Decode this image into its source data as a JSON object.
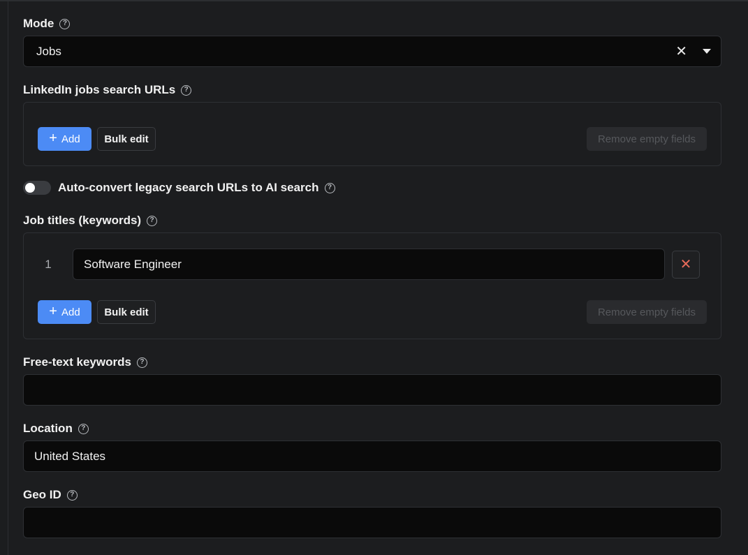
{
  "mode": {
    "label": "Mode",
    "value": "Jobs"
  },
  "linkedin_urls": {
    "label": "LinkedIn jobs search URLs",
    "add_label": "Add",
    "bulk_edit_label": "Bulk edit",
    "remove_empty_label": "Remove empty fields"
  },
  "auto_convert": {
    "label": "Auto-convert legacy search URLs to AI search",
    "enabled": false
  },
  "job_titles": {
    "label": "Job titles (keywords)",
    "items": [
      {
        "index": "1",
        "value": "Software Engineer"
      }
    ],
    "add_label": "Add",
    "bulk_edit_label": "Bulk edit",
    "remove_empty_label": "Remove empty fields"
  },
  "free_text": {
    "label": "Free-text keywords",
    "value": ""
  },
  "location": {
    "label": "Location",
    "value": "United States"
  },
  "geo_id": {
    "label": "Geo ID",
    "value": ""
  },
  "colors": {
    "accent": "#4c8bf5",
    "background": "#1c1d1f",
    "input_bg": "#0a0a0a",
    "danger": "#e86b5a"
  }
}
